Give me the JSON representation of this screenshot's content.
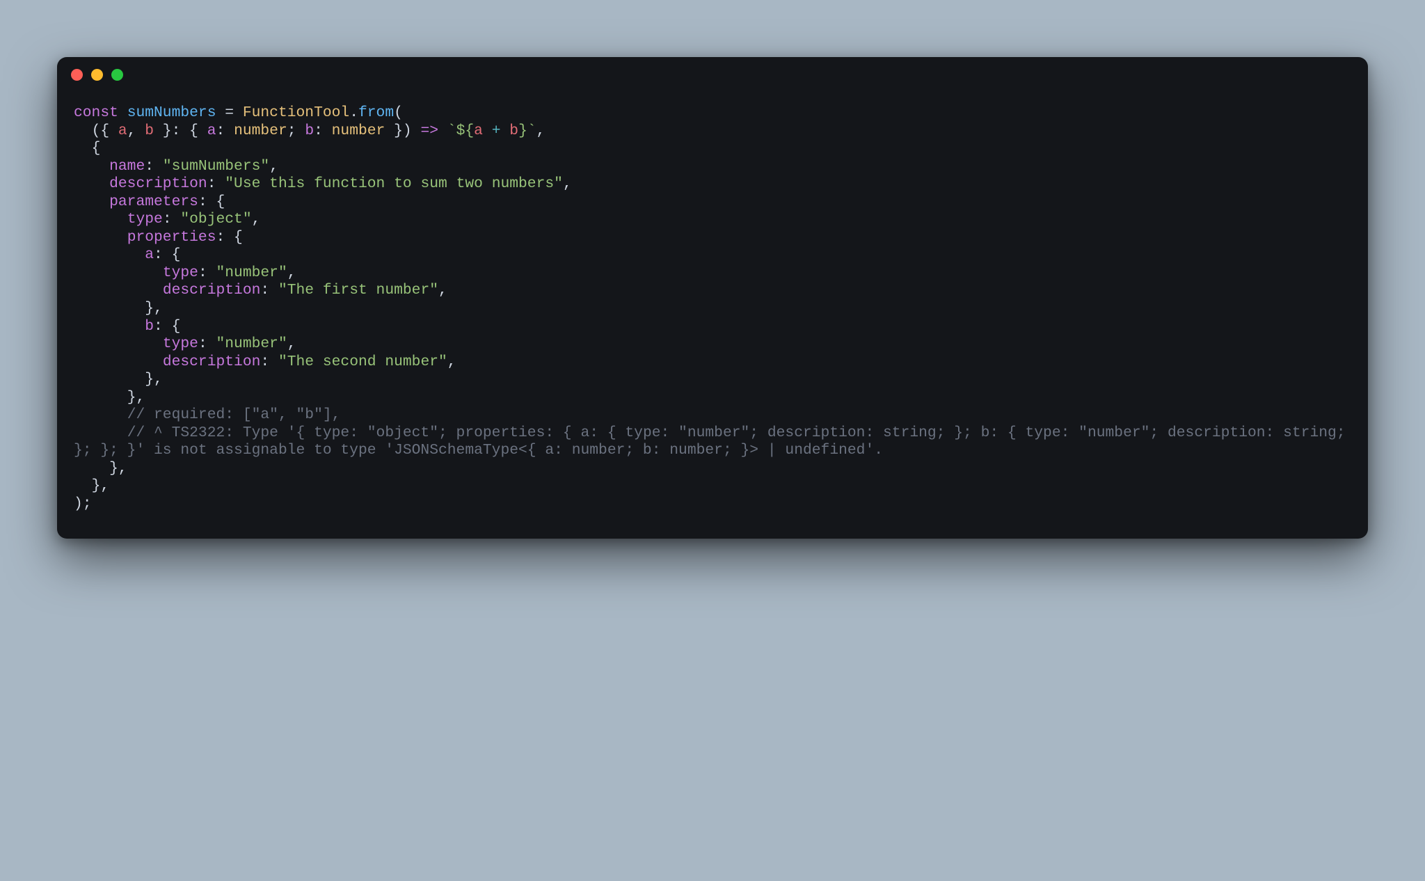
{
  "theme": {
    "pageBg": "#a8b7c4",
    "windowBg": "#14161a",
    "text": "#d7dee7",
    "keyword": "#c678dd",
    "function": "#5fb4f1",
    "class": "#e5c07b",
    "param": "#e06c75",
    "string": "#98c379",
    "operator": "#56b6c2",
    "comment": "#6b7280"
  },
  "window": {
    "trafficLights": [
      "close",
      "minimize",
      "maximize"
    ]
  },
  "code": {
    "language": "typescript",
    "tokens": [
      [
        [
          "kw",
          "const"
        ],
        [
          "punc",
          " "
        ],
        [
          "fn",
          "sumNumbers"
        ],
        [
          "punc",
          " "
        ],
        [
          "punc",
          "="
        ],
        [
          "punc",
          " "
        ],
        [
          "class",
          "FunctionTool"
        ],
        [
          "punc",
          "."
        ],
        [
          "fn",
          "from"
        ],
        [
          "punc",
          "("
        ]
      ],
      [
        [
          "punc",
          "  ("
        ],
        [
          "punc",
          "{ "
        ],
        [
          "param",
          "a"
        ],
        [
          "punc",
          ", "
        ],
        [
          "param",
          "b"
        ],
        [
          "punc",
          " }"
        ],
        [
          "punc",
          ": "
        ],
        [
          "punc",
          "{ "
        ],
        [
          "prop",
          "a"
        ],
        [
          "punc",
          ": "
        ],
        [
          "class",
          "number"
        ],
        [
          "punc",
          "; "
        ],
        [
          "prop",
          "b"
        ],
        [
          "punc",
          ": "
        ],
        [
          "class",
          "number"
        ],
        [
          "punc",
          " }) "
        ],
        [
          "arrow",
          "=>"
        ],
        [
          "punc",
          " "
        ],
        [
          "tmpl",
          "`"
        ],
        [
          "tmpl",
          "${"
        ],
        [
          "param",
          "a"
        ],
        [
          "punc",
          " "
        ],
        [
          "op",
          "+"
        ],
        [
          "punc",
          " "
        ],
        [
          "param",
          "b"
        ],
        [
          "tmpl",
          "}"
        ],
        [
          "tmpl",
          "`"
        ],
        [
          "punc",
          ","
        ]
      ],
      [
        [
          "punc",
          "  {"
        ]
      ],
      [
        [
          "punc",
          "    "
        ],
        [
          "prop",
          "name"
        ],
        [
          "punc",
          ": "
        ],
        [
          "str",
          "\"sumNumbers\""
        ],
        [
          "punc",
          ","
        ]
      ],
      [
        [
          "punc",
          "    "
        ],
        [
          "prop",
          "description"
        ],
        [
          "punc",
          ": "
        ],
        [
          "str",
          "\"Use this function to sum two numbers\""
        ],
        [
          "punc",
          ","
        ]
      ],
      [
        [
          "punc",
          "    "
        ],
        [
          "prop",
          "parameters"
        ],
        [
          "punc",
          ": {"
        ]
      ],
      [
        [
          "punc",
          "      "
        ],
        [
          "prop",
          "type"
        ],
        [
          "punc",
          ": "
        ],
        [
          "str",
          "\"object\""
        ],
        [
          "punc",
          ","
        ]
      ],
      [
        [
          "punc",
          "      "
        ],
        [
          "prop",
          "properties"
        ],
        [
          "punc",
          ": {"
        ]
      ],
      [
        [
          "punc",
          "        "
        ],
        [
          "prop",
          "a"
        ],
        [
          "punc",
          ": {"
        ]
      ],
      [
        [
          "punc",
          "          "
        ],
        [
          "prop",
          "type"
        ],
        [
          "punc",
          ": "
        ],
        [
          "str",
          "\"number\""
        ],
        [
          "punc",
          ","
        ]
      ],
      [
        [
          "punc",
          "          "
        ],
        [
          "prop",
          "description"
        ],
        [
          "punc",
          ": "
        ],
        [
          "str",
          "\"The first number\""
        ],
        [
          "punc",
          ","
        ]
      ],
      [
        [
          "punc",
          "        },"
        ]
      ],
      [
        [
          "punc",
          "        "
        ],
        [
          "prop",
          "b"
        ],
        [
          "punc",
          ": {"
        ]
      ],
      [
        [
          "punc",
          "          "
        ],
        [
          "prop",
          "type"
        ],
        [
          "punc",
          ": "
        ],
        [
          "str",
          "\"number\""
        ],
        [
          "punc",
          ","
        ]
      ],
      [
        [
          "punc",
          "          "
        ],
        [
          "prop",
          "description"
        ],
        [
          "punc",
          ": "
        ],
        [
          "str",
          "\"The second number\""
        ],
        [
          "punc",
          ","
        ]
      ],
      [
        [
          "punc",
          "        },"
        ]
      ],
      [
        [
          "punc",
          "      },"
        ]
      ],
      [
        [
          "punc",
          "      "
        ],
        [
          "cmt",
          "// required: [\"a\", \"b\"],"
        ]
      ],
      [
        [
          "punc",
          "      "
        ],
        [
          "cmt",
          "// ^ TS2322: Type '{ type: \"object\"; properties: { a: { type: \"number\"; description: string; }; b: { type: \"number\"; description: string; }; }; }' is not assignable to type 'JSONSchemaType<{ a: number; b: number; }> | undefined'."
        ]
      ],
      [
        [
          "punc",
          "    },"
        ]
      ],
      [
        [
          "punc",
          "  },"
        ]
      ],
      [
        [
          "punc",
          ");"
        ]
      ]
    ]
  }
}
